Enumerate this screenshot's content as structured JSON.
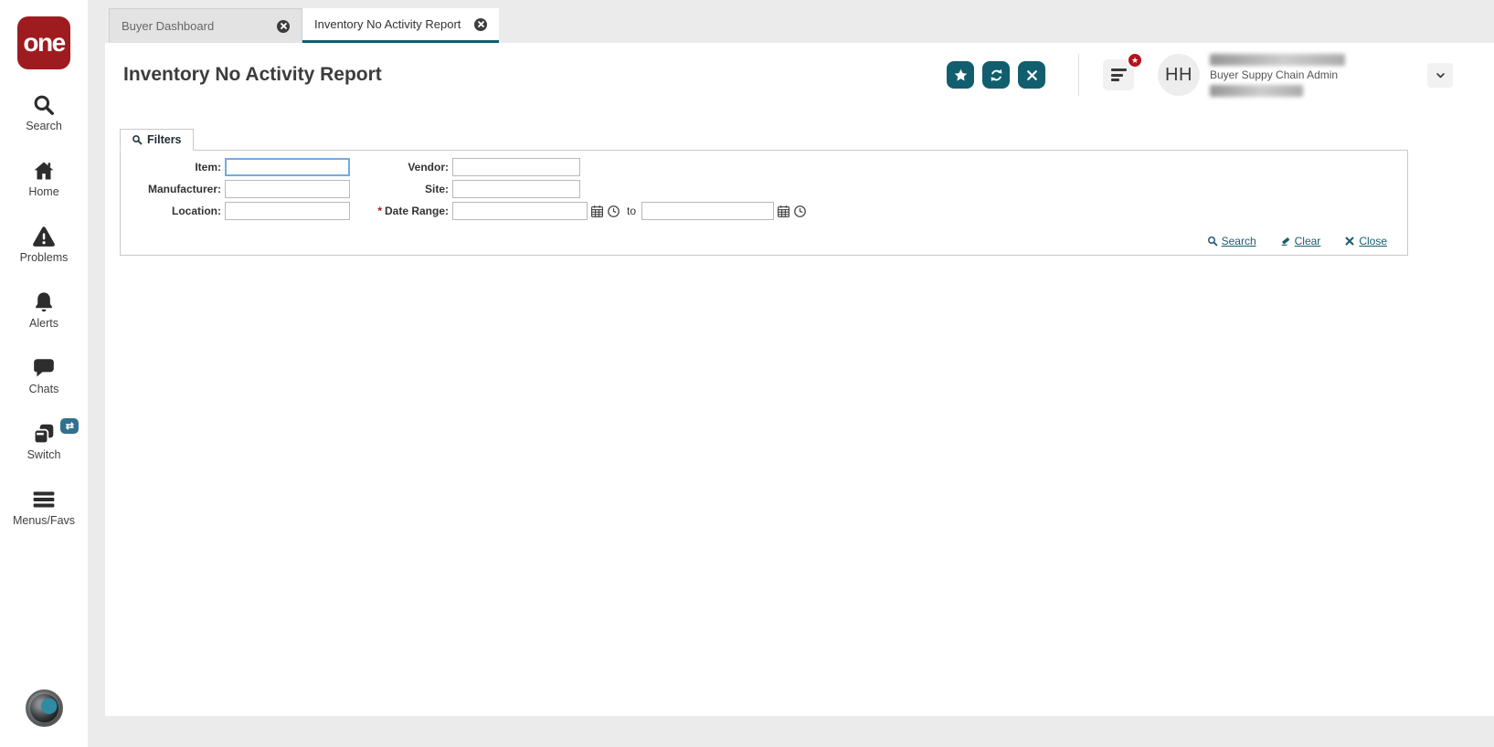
{
  "brand": {
    "logo_text": "one"
  },
  "sidebar": {
    "items": [
      {
        "label": "Search"
      },
      {
        "label": "Home"
      },
      {
        "label": "Problems"
      },
      {
        "label": "Alerts"
      },
      {
        "label": "Chats"
      },
      {
        "label": "Switch"
      },
      {
        "label": "Menus/Favs"
      }
    ]
  },
  "tabstrip": {
    "tabs": [
      {
        "label": "Buyer Dashboard",
        "active": false
      },
      {
        "label": "Inventory No Activity Report",
        "active": true
      }
    ]
  },
  "header": {
    "title": "Inventory No Activity Report",
    "user": {
      "initials": "HH",
      "role": "Buyer Suppy Chain Admin"
    },
    "badge_star": "★"
  },
  "filters": {
    "tab_label": "Filters",
    "labels": {
      "item": "Item:",
      "vendor": "Vendor:",
      "manufacturer": "Manufacturer:",
      "site": "Site:",
      "location": "Location:",
      "date_range": "Date Range:",
      "required_marker": "*",
      "date_to": "to"
    },
    "values": {
      "item": "",
      "vendor": "",
      "manufacturer": "",
      "site": "",
      "location": "",
      "date_from": "",
      "date_to": ""
    },
    "actions": {
      "search": "Search",
      "clear": "Clear",
      "close": "Close"
    }
  },
  "colors": {
    "accent_teal": "#115E6F",
    "tab_underline": "#0C6070",
    "logo_red": "#9E1B1F",
    "badge_red": "#B5121B",
    "switch_badge_blue": "#31708F",
    "focus_border": "#74ABDB",
    "link": "#1C5A70"
  }
}
